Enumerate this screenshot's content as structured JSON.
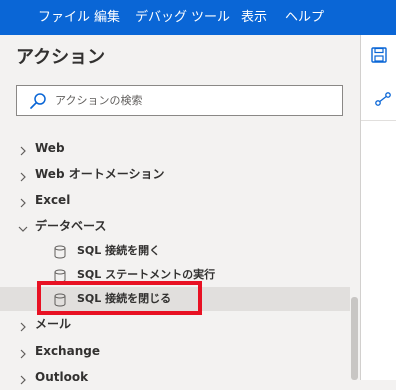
{
  "menubar": {
    "items": [
      "ファイル",
      "編集",
      "デバッグ",
      "ツール",
      "表示",
      "ヘルプ"
    ]
  },
  "panel": {
    "title": "アクション",
    "search": {
      "placeholder": "アクションの検索",
      "value": ""
    },
    "tree": [
      {
        "label": "Web",
        "expanded": false
      },
      {
        "label": "Web オートメーション",
        "expanded": false
      },
      {
        "label": "Excel",
        "expanded": false
      },
      {
        "label": "データベース",
        "expanded": true,
        "children": [
          {
            "label": "SQL 接続を開く",
            "selected": false
          },
          {
            "label": "SQL ステートメントの実行",
            "selected": false
          },
          {
            "label": "SQL 接続を閉じる",
            "selected": true
          }
        ]
      },
      {
        "label": "メール",
        "expanded": false
      },
      {
        "label": "Exchange",
        "expanded": false
      },
      {
        "label": "Outlook",
        "expanded": false
      }
    ]
  },
  "right_toolbar": {
    "icons": [
      "save-icon",
      "variable-icon"
    ]
  },
  "colors": {
    "menubar": "#0a66d6",
    "highlight": "#e81123",
    "selected_row": "#e1dfdd",
    "accent_icon": "#0a66d6"
  }
}
